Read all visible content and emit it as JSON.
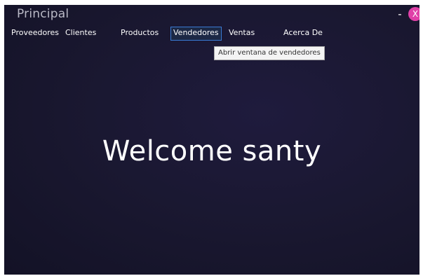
{
  "window": {
    "title": "Principal",
    "minimize_label": "-",
    "close_label": "X",
    "close_color": "#e040a8",
    "background_color": "#1a1833"
  },
  "menu": {
    "items": [
      {
        "label": "Proveedores"
      },
      {
        "label": "Clientes"
      },
      {
        "label": "Productos"
      },
      {
        "label": "Vendedores",
        "active": true
      },
      {
        "label": "Ventas"
      },
      {
        "label": "Acerca De"
      }
    ]
  },
  "tooltip": {
    "text": "Abrir ventana de vendedores"
  },
  "main": {
    "welcome_text": "Welcome santy"
  }
}
